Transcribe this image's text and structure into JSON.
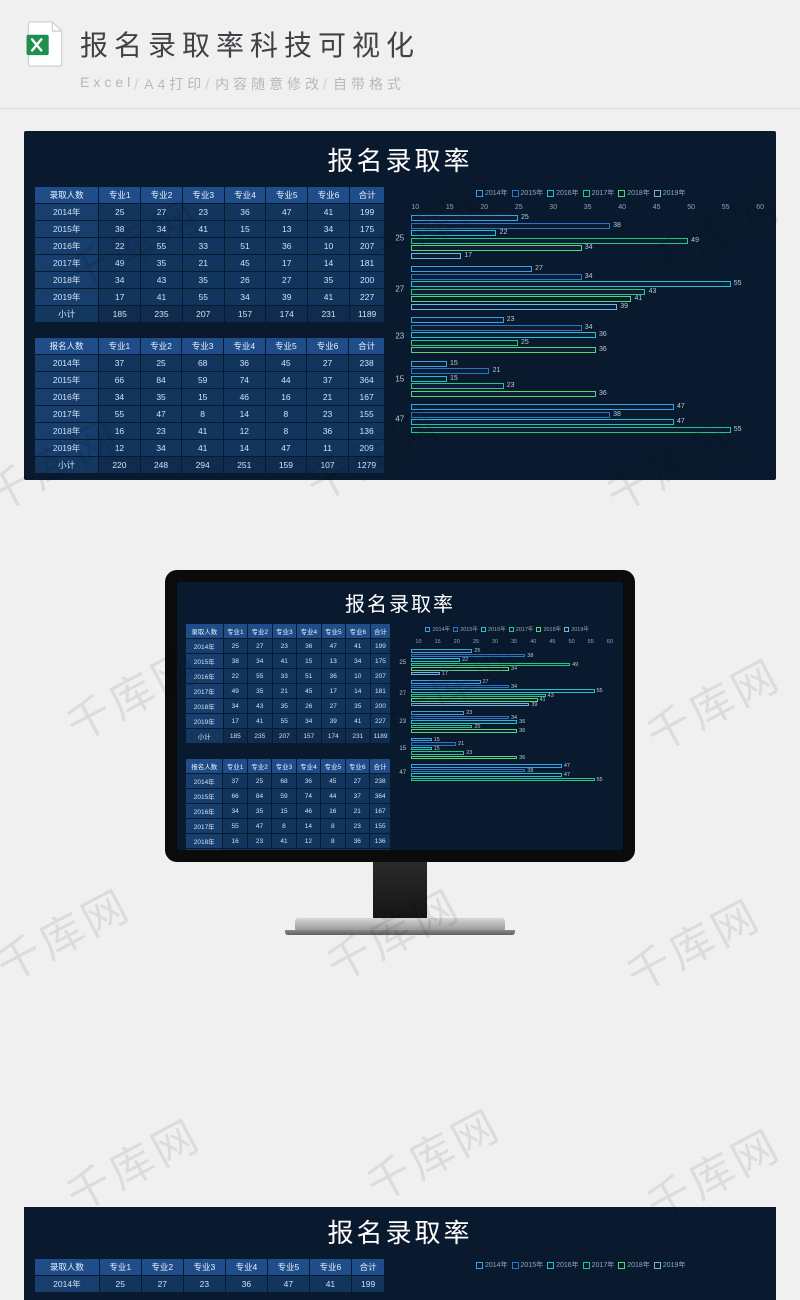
{
  "header": {
    "title": "报名录取率科技可视化",
    "tags": [
      "Excel",
      "A4打印",
      "内容随意修改",
      "自带格式"
    ]
  },
  "dashboard": {
    "title": "报名录取率",
    "columns": [
      "专业1",
      "专业2",
      "专业3",
      "专业4",
      "专业5",
      "专业6",
      "合计"
    ],
    "row_label_subtotal": "小计",
    "table1": {
      "corner": "录取人数",
      "rows": [
        {
          "l": "2014年",
          "v": [
            25,
            27,
            23,
            36,
            47,
            41,
            199
          ]
        },
        {
          "l": "2015年",
          "v": [
            38,
            34,
            41,
            15,
            13,
            34,
            175
          ]
        },
        {
          "l": "2016年",
          "v": [
            22,
            55,
            33,
            51,
            36,
            10,
            207
          ]
        },
        {
          "l": "2017年",
          "v": [
            49,
            35,
            21,
            45,
            17,
            14,
            181
          ]
        },
        {
          "l": "2018年",
          "v": [
            34,
            43,
            35,
            26,
            27,
            35,
            200
          ]
        },
        {
          "l": "2019年",
          "v": [
            17,
            41,
            55,
            34,
            39,
            41,
            227
          ]
        }
      ],
      "subtotal": [
        185,
        235,
        207,
        157,
        174,
        231,
        1189
      ]
    },
    "table2": {
      "corner": "报名人数",
      "rows": [
        {
          "l": "2014年",
          "v": [
            37,
            25,
            68,
            36,
            45,
            27,
            238
          ]
        },
        {
          "l": "2015年",
          "v": [
            66,
            84,
            59,
            74,
            44,
            37,
            364
          ]
        },
        {
          "l": "2016年",
          "v": [
            34,
            35,
            15,
            46,
            16,
            21,
            167
          ]
        },
        {
          "l": "2017年",
          "v": [
            55,
            47,
            8,
            14,
            8,
            23,
            155
          ]
        },
        {
          "l": "2018年",
          "v": [
            16,
            23,
            41,
            12,
            8,
            36,
            136
          ]
        },
        {
          "l": "2019年",
          "v": [
            12,
            34,
            41,
            14,
            47,
            11,
            209
          ]
        }
      ],
      "subtotal": [
        220,
        248,
        294,
        251,
        159,
        107,
        1279
      ]
    }
  },
  "chart_data": {
    "type": "bar",
    "orientation": "horizontal",
    "title": "",
    "xlabel": "",
    "ylabel": "",
    "xlim": [
      10,
      60
    ],
    "xticks": [
      10,
      15,
      20,
      25,
      30,
      35,
      40,
      45,
      50,
      55,
      60
    ],
    "legend": [
      "2014年",
      "2015年",
      "2016年",
      "2017年",
      "2018年",
      "2019年"
    ],
    "legend_colors": [
      "#3aa0e8",
      "#2c74c6",
      "#23c0d1",
      "#22c988",
      "#5ad47a",
      "#6fb6e6"
    ],
    "categories": [
      25,
      27,
      23,
      15,
      47
    ],
    "series": [
      {
        "name": "2014年",
        "values": [
          25,
          27,
          23,
          15,
          47
        ]
      },
      {
        "name": "2015年",
        "values": [
          38,
          34,
          34,
          21,
          38
        ]
      },
      {
        "name": "2016年",
        "values": [
          22,
          55,
          36,
          15,
          47
        ]
      },
      {
        "name": "2017年",
        "values": [
          49,
          43,
          25,
          23,
          55
        ]
      },
      {
        "name": "2018年",
        "values": [
          34,
          41,
          36,
          36,
          null
        ]
      },
      {
        "name": "2019年",
        "values": [
          17,
          39,
          null,
          null,
          null
        ]
      }
    ]
  },
  "watermark": "千库网"
}
